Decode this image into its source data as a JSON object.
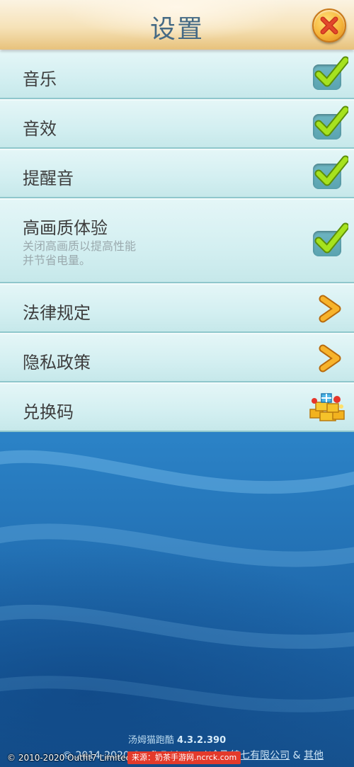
{
  "header": {
    "title": "设置",
    "close_icon": "close-icon"
  },
  "settings": {
    "music": {
      "label": "音乐",
      "checked": true
    },
    "sfx": {
      "label": "音效",
      "checked": true
    },
    "reminder": {
      "label": "提醒音",
      "checked": true
    },
    "hq": {
      "label": "高画质体验",
      "sub_line1": "关闭高画质以提高性能",
      "sub_line2": "并节省电量。",
      "checked": true
    },
    "legal": {
      "label": "法律规定"
    },
    "privacy": {
      "label": "隐私政策"
    },
    "redeem": {
      "label": "兑换码"
    }
  },
  "footer": {
    "game_name": "汤姆猫跑酷",
    "version": "4.3.2.390",
    "line2_prefix": "© 2014-2020 Outfit7 Limited/",
    "line2_link": "金飞特七有限公司",
    "line2_amp": "&",
    "line2_other": "其他",
    "copyright": "© 2010-2020 Outfit7 Limited. All rights reserved.",
    "watermark": "来源：奶茶手游网.ncrck.com"
  },
  "colors": {
    "check": "#9fd81c",
    "arrow": "#f5a623",
    "title": "#456a85"
  }
}
